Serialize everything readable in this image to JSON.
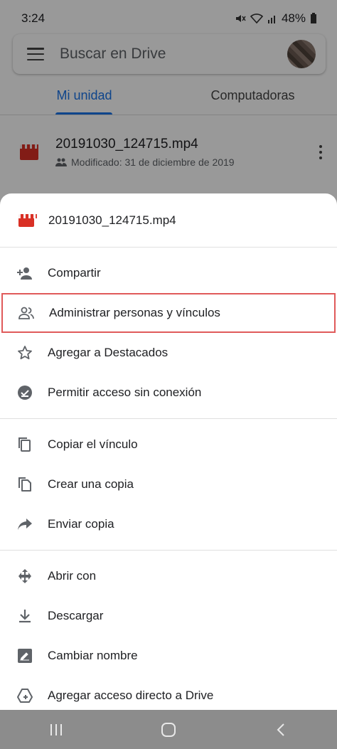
{
  "status": {
    "time": "3:24",
    "battery": "48%"
  },
  "search": {
    "placeholder": "Buscar en Drive"
  },
  "tabs": [
    {
      "label": "Mi unidad",
      "active": true
    },
    {
      "label": "Computadoras",
      "active": false
    }
  ],
  "file": {
    "name": "20191030_124715.mp4",
    "meta": "Modificado: 31 de diciembre de 2019"
  },
  "sheet": {
    "title": "20191030_124715.mp4",
    "groups": [
      [
        {
          "label": "Compartir",
          "icon": "person-add-icon"
        },
        {
          "label": "Administrar personas y vínculos",
          "icon": "people-icon",
          "highlighted": true
        },
        {
          "label": "Agregar a Destacados",
          "icon": "star-icon"
        },
        {
          "label": "Permitir acceso sin conexión",
          "icon": "offline-check-icon"
        }
      ],
      [
        {
          "label": "Copiar el vínculo",
          "icon": "copy-link-icon"
        },
        {
          "label": "Crear una copia",
          "icon": "file-copy-icon"
        },
        {
          "label": "Enviar copia",
          "icon": "share-arrow-icon"
        }
      ],
      [
        {
          "label": "Abrir con",
          "icon": "open-with-icon"
        },
        {
          "label": "Descargar",
          "icon": "download-icon"
        },
        {
          "label": "Cambiar nombre",
          "icon": "rename-icon"
        },
        {
          "label": "Agregar acceso directo a Drive",
          "icon": "drive-shortcut-icon"
        }
      ]
    ]
  },
  "colors": {
    "accent": "#1a73e8",
    "video_red": "#d93025",
    "highlight_border": "#e05a5a"
  }
}
